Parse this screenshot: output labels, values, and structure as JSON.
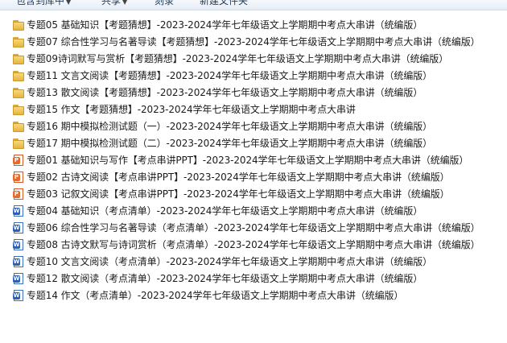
{
  "toolbar": {
    "items": [
      {
        "label": "包含到库中",
        "arrow": "▼"
      },
      {
        "label": "共享",
        "arrow": "▼"
      },
      {
        "label": "刻录",
        "arrow": ""
      },
      {
        "label": "新建文件夹",
        "arrow": ""
      }
    ]
  },
  "files": [
    {
      "type": "folder",
      "name": "专题05 基础知识【考题猜想】-2023-2024学年七年级语文上学期期中考点大串讲（统编版）"
    },
    {
      "type": "folder",
      "name": "专题07 综合性学习与名著导读【考题猜想】-2023-2024学年七年级语文上学期期中考点大串讲（统编版）"
    },
    {
      "type": "folder",
      "name": "专题09诗词默写与赏析【考题猜想】-2023-2024学年七年级语文上学期期中考点大串讲（统编版）"
    },
    {
      "type": "folder",
      "name": "专题11 文言文阅读【考题猜想】-2023-2024学年七年级语文上学期期中考点大串讲（统编版）"
    },
    {
      "type": "folder",
      "name": "专题13 散文阅读【考题猜想】-2023-2024学年七年级语文上学期期中考点大串讲（统编版）"
    },
    {
      "type": "folder",
      "name": "专题15 作文【考题猜想】-2023-2024学年七年级语文上学期期中考点大串讲"
    },
    {
      "type": "folder",
      "name": "专题16 期中模拟检测试题（一）-2023-2024学年七年级语文上学期期中考点大串讲（统编版）"
    },
    {
      "type": "folder",
      "name": "专题17 期中模拟检测试题（二）-2023-2024学年七年级语文上学期期中考点大串讲（统编版）"
    },
    {
      "type": "ppt",
      "name": "专题01 基础知识与写作【考点串讲PPT】-2023-2024学年七年级语文上学期期中考点大串讲（统编版）"
    },
    {
      "type": "ppt",
      "name": "专题02 古诗文阅读【考点串讲PPT】-2023-2024学年七年级语文上学期期中考点大串讲（统编版）"
    },
    {
      "type": "ppt",
      "name": "专题03 记叙文阅读【考点串讲PPT】-2023-2024学年七年级语文上学期期中考点大串讲（统编版）"
    },
    {
      "type": "word",
      "name": "专题04 基础知识（考点清单）-2023-2024学年七年级语文上学期期中考点大串讲（统编版）"
    },
    {
      "type": "word",
      "name": "专题06 综合性学习与名著导读（考点清单）-2023-2024学年七年级语文上学期期中考点大串讲（统编版）"
    },
    {
      "type": "word",
      "name": "专题08 古诗文默写与诗词赏析（考点清单）-2023-2024学年七年级语文上学期期中考点大串讲（统编版）"
    },
    {
      "type": "word",
      "name": "专题10 文言文阅读（考点清单）-2023-2024学年七年级语文上学期期中考点大串讲（统编版）"
    },
    {
      "type": "word",
      "name": "专题12 散文阅读（考点清单）-2023-2024学年七年级语文上学期期中考点大串讲（统编版）"
    },
    {
      "type": "word",
      "name": "专题14 作文（考点清单）-2023-2024学年七年级语文上学期期中考点大串讲（统编版）"
    }
  ]
}
